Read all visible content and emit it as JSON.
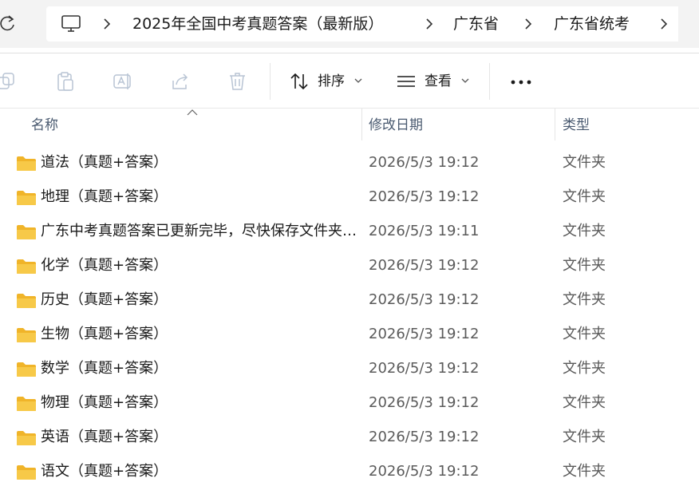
{
  "breadcrumb": {
    "items": [
      {
        "label": "2025年全国中考真题答案（最新版）"
      },
      {
        "label": "广东省"
      },
      {
        "label": "广东省统考"
      }
    ]
  },
  "toolbar": {
    "sort_label": "排序",
    "view_label": "查看"
  },
  "columns": {
    "name": "名称",
    "date": "修改日期",
    "type": "类型"
  },
  "files": [
    {
      "name": "道法（真题+答案）",
      "date": "2026/5/3 19:12",
      "type": "文件夹"
    },
    {
      "name": "地理（真题+答案）",
      "date": "2026/5/3 19:12",
      "type": "文件夹"
    },
    {
      "name": "广东中考真题答案已更新完毕，尽快保存文件夹…",
      "date": "2026/5/3 19:11",
      "type": "文件夹"
    },
    {
      "name": "化学（真题+答案）",
      "date": "2026/5/3 19:12",
      "type": "文件夹"
    },
    {
      "name": "历史（真题+答案）",
      "date": "2026/5/3 19:12",
      "type": "文件夹"
    },
    {
      "name": "生物（真题+答案）",
      "date": "2026/5/3 19:12",
      "type": "文件夹"
    },
    {
      "name": "数学（真题+答案）",
      "date": "2026/5/3 19:12",
      "type": "文件夹"
    },
    {
      "name": "物理（真题+答案）",
      "date": "2026/5/3 19:12",
      "type": "文件夹"
    },
    {
      "name": "英语（真题+答案）",
      "date": "2026/5/3 19:12",
      "type": "文件夹"
    },
    {
      "name": "语文（真题+答案）",
      "date": "2026/5/3 19:12",
      "type": "文件夹"
    }
  ],
  "colors": {
    "folder": "#f7c948",
    "header_text": "#4a5a70",
    "address_bg": "#f3f3f3"
  }
}
